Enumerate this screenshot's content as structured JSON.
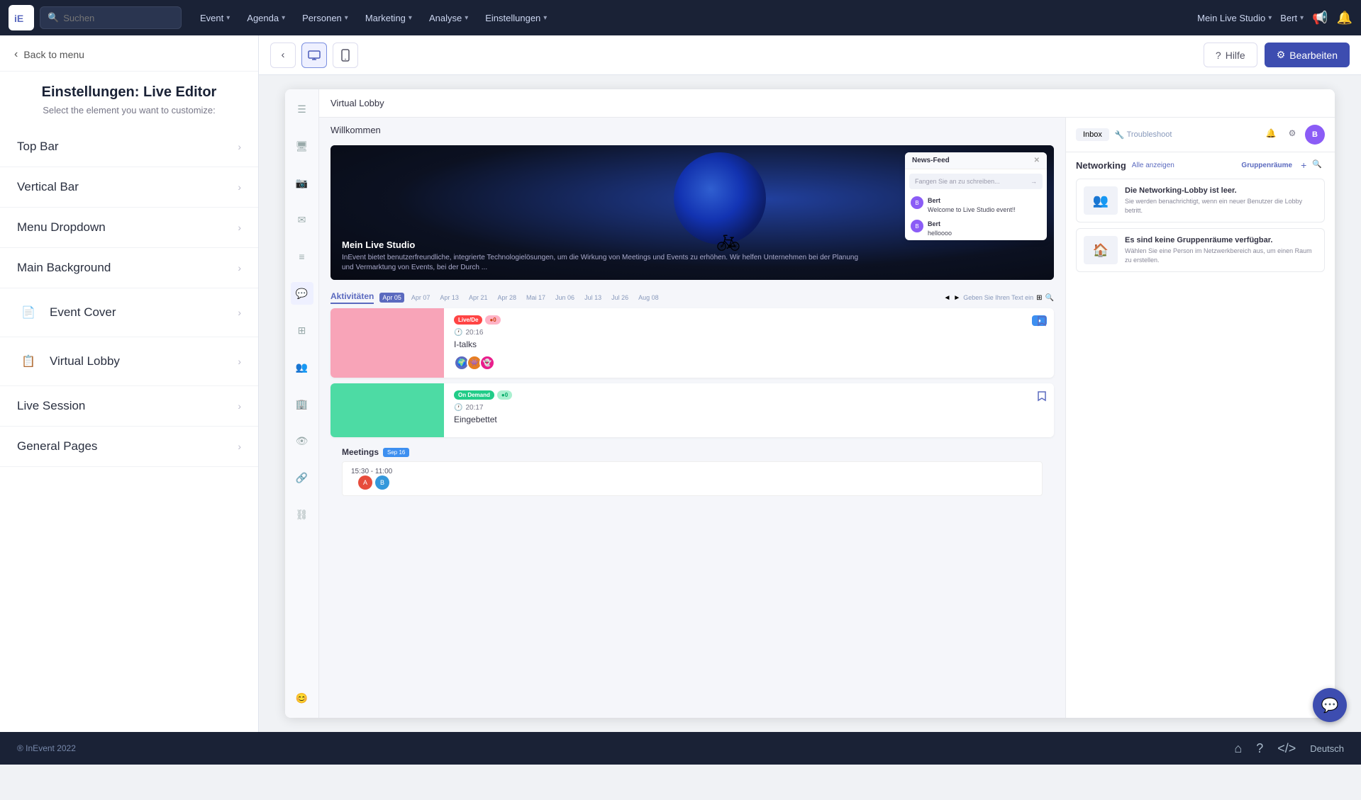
{
  "topnav": {
    "logo": "iE",
    "search_placeholder": "Suchen",
    "menu_items": [
      {
        "label": "Event",
        "has_dropdown": true
      },
      {
        "label": "Agenda",
        "has_dropdown": true
      },
      {
        "label": "Personen",
        "has_dropdown": true
      },
      {
        "label": "Marketing",
        "has_dropdown": true
      },
      {
        "label": "Analyse",
        "has_dropdown": true
      },
      {
        "label": "Einstellungen",
        "has_dropdown": true
      }
    ],
    "studio_label": "Mein Live Studio",
    "user_label": "Bert",
    "megaphone_icon": "📢",
    "bell_icon": "🔔"
  },
  "sidebar": {
    "back_label": "Back to menu",
    "title": "Einstellungen: Live Editor",
    "subtitle": "Select the element you want to customize:",
    "items": [
      {
        "label": "Top Bar",
        "has_icon": false
      },
      {
        "label": "Vertical Bar",
        "has_icon": false
      },
      {
        "label": "Menu Dropdown",
        "has_icon": false
      },
      {
        "label": "Main Background",
        "has_icon": false
      },
      {
        "label": "Event Cover",
        "has_icon": true
      },
      {
        "label": "Virtual Lobby",
        "has_icon": true
      },
      {
        "label": "Live Session",
        "has_icon": false
      },
      {
        "label": "General Pages",
        "has_icon": false
      }
    ]
  },
  "toolbar": {
    "back_icon": "‹",
    "desktop_icon": "🖥",
    "mobile_icon": "📱",
    "help_label": "Hilfe",
    "edit_label": "Bearbeiten"
  },
  "preview": {
    "topbar_title": "Virtual Lobby",
    "welcome_text": "Willkommen",
    "hero_name": "Mein Live Studio",
    "hero_desc": "InEvent bietet benutzerfreundliche, integrierte Technologielösungen, um die Wirkung von Meetings und Events zu erhöhen. Wir helfen Unternehmen bei der Planung und Vermarktung von Events, bei der Durch ...",
    "chat_title": "News-Feed",
    "chat_placeholder": "Fangen Sie an zu schreiben...",
    "chat_messages": [
      {
        "user": "Bert",
        "text": "Welcome to Live Studio event!!",
        "avatar_color": "#8b5cf6"
      },
      {
        "user": "Bert",
        "text": "helloooo",
        "avatar_color": "#8b5cf6"
      }
    ],
    "activities_title": "Aktivitäten",
    "activities_date": "Apr 05",
    "date_tabs": [
      "Apr 07",
      "Apr 13",
      "Apr 21",
      "Apr 28",
      "Mai 17",
      "Jun 06",
      "Jul 13",
      "Jul 26",
      "Aug 08"
    ],
    "activity_cards": [
      {
        "badges": [
          "Live/De",
          "●0"
        ],
        "badge_types": [
          "live",
          "pink-bg"
        ],
        "time": "20:16",
        "name": "I-talks",
        "thumb_color": "pink",
        "action": "●"
      },
      {
        "badges": [
          "On Demand",
          "●0"
        ],
        "badge_types": [
          "on-demand",
          "green-bg"
        ],
        "time": "20:17",
        "name": "Eingebettet",
        "thumb_color": "teal",
        "action": null
      }
    ],
    "networking_title": "Networking",
    "networking_link": "Alle anzeigen",
    "networking_tab": "Gruppenräume",
    "networking_empty1": "Die Networking-Lobby ist leer.",
    "networking_desc1": "Sie werden benachrichtigt, wenn ein neuer Benutzer die Lobby betritt.",
    "networking_empty2": "Es sind keine Gruppenräume verfügbar.",
    "networking_desc2": "Wählen Sie eine Person im Netzwerkbereich aus, um einen Raum zu erstellen.",
    "meetings_title": "Meetings",
    "meetings_date": "Sep 16",
    "meetings_time": "15:30 - 11:00"
  },
  "bottom": {
    "copyright": "® InEvent 2022",
    "lang": "Deutsch"
  }
}
